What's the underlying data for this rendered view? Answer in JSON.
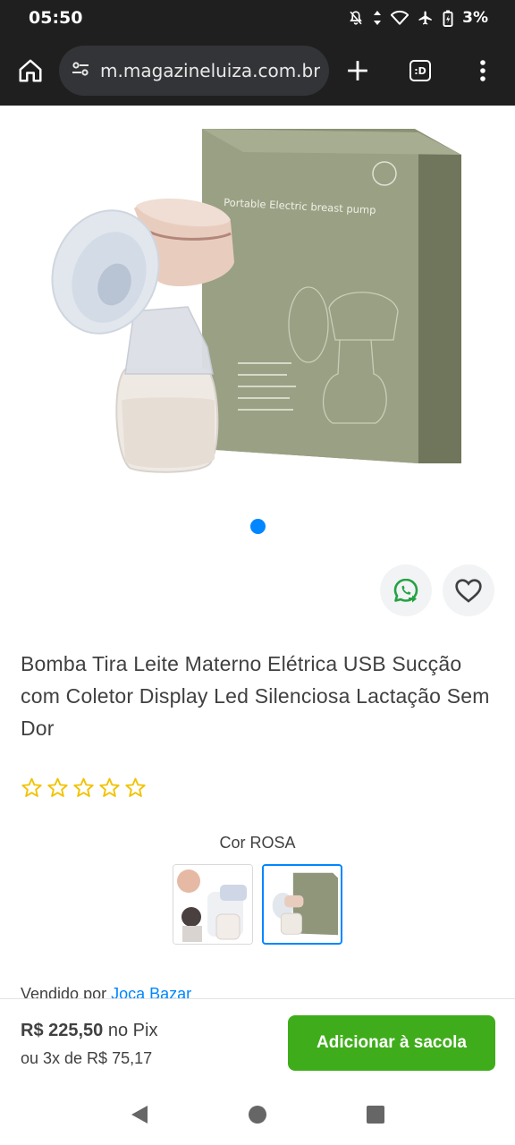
{
  "status_bar": {
    "time": "05:50",
    "battery": "3%"
  },
  "browser": {
    "url": "m.magazineluiza.com.br",
    "tabs_label": ":D"
  },
  "product": {
    "title": "Bomba Tira Leite Materno Elétrica USB Sucção com Coletor Display Led Silenciosa Lactação Sem Dor",
    "rating_stars": 0,
    "image_box_text": "Portable Electric breast pump",
    "color_label": "Cor ROSA",
    "carousel": {
      "count": 1,
      "active": 1
    }
  },
  "seller": {
    "prefix": "Vendido por",
    "name": "Joca Bazar"
  },
  "purchase": {
    "price": "R$ 225,50",
    "price_suffix": "no Pix",
    "installments": "ou 3x de R$ 75,17",
    "add_button": "Adicionar à sacola"
  },
  "colors": {
    "accent_blue": "#0086ff",
    "buy_green": "#3fad1b",
    "whatsapp_green": "#25a244",
    "star_yellow": "#f2c200"
  }
}
